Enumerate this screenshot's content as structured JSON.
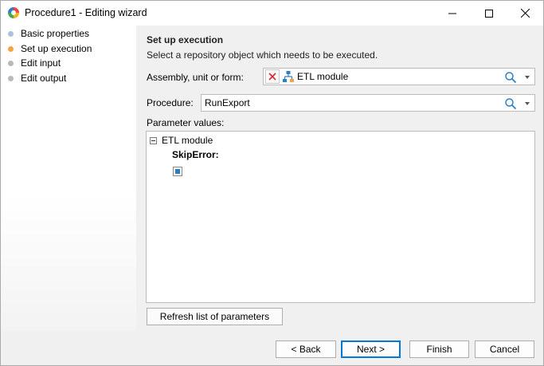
{
  "window": {
    "title": "Procedure1 - Editing wizard"
  },
  "nav": {
    "items": [
      {
        "label": "Basic properties",
        "dot_color": "#a9c2dd"
      },
      {
        "label": "Set up execution",
        "dot_color": "#f0a540"
      },
      {
        "label": "Edit input",
        "dot_color": "#b9b9b9"
      },
      {
        "label": "Edit output",
        "dot_color": "#b9b9b9"
      }
    ]
  },
  "main": {
    "section_title": "Set up execution",
    "section_description": "Select a repository object which needs to be executed.",
    "assembly_label": "Assembly, unit or form:",
    "assembly_value": "ETL module",
    "procedure_label": "Procedure:",
    "procedure_value": "RunExport",
    "parameter_values_label": "Parameter values:",
    "tree_node": "ETL module",
    "param_name": "SkipError:",
    "param_checked": true,
    "refresh_button": "Refresh list of parameters"
  },
  "footer": {
    "back": "< Back",
    "next": "Next >",
    "finish": "Finish",
    "cancel": "Cancel"
  },
  "colors": {
    "accent": "#0078d7",
    "checkbox_fill": "#2b7ec1",
    "clear_x": "#d9272e",
    "module_icon": "#2f7fc4"
  }
}
